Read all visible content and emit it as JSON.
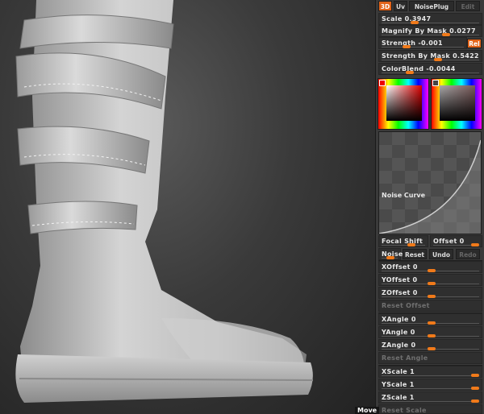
{
  "tabs": {
    "t3d": "3D",
    "uv": "Uv",
    "noiseplug": "NoisePlug",
    "edit": "Edit"
  },
  "sliders": {
    "scale": {
      "label": "Scale",
      "value": "0.3947",
      "level": 0.39
    },
    "magnify": {
      "label": "Magnify By Mask",
      "value": "0.0277",
      "level": 0.62
    },
    "strength": {
      "label": "Strength",
      "value": "-0.001",
      "level": 0.25
    },
    "rel": "Rel",
    "strength_mask": {
      "label": "Strength By Mask",
      "value": "0.5422",
      "level": 0.54
    },
    "colorblend": {
      "label": "ColorBlend",
      "value": "-0.0044",
      "level": 0.2
    }
  },
  "curve": {
    "label": "Noise Curve"
  },
  "focal": {
    "label": "Focal Shift",
    "level": 0.6
  },
  "offset": {
    "label": "Offset",
    "value": "0",
    "level": 0.85
  },
  "noise_row": {
    "label": "Noise",
    "reset": "Reset",
    "undo": "Undo",
    "redo": "Redo"
  },
  "axes": {
    "xoffset": {
      "label": "XOffset",
      "value": "0",
      "level": 0.5
    },
    "yoffset": {
      "label": "YOffset",
      "value": "0",
      "level": 0.5
    },
    "zoffset": {
      "label": "ZOffset",
      "value": "0",
      "level": 0.5
    },
    "reset_offset": "Reset Offset",
    "xangle": {
      "label": "XAngle",
      "value": "0",
      "level": 0.5
    },
    "yangle": {
      "label": "YAngle",
      "value": "0",
      "level": 0.5
    },
    "zangle": {
      "label": "ZAngle",
      "value": "0",
      "level": 0.5
    },
    "reset_angle": "Reset Angle",
    "xscale": {
      "label": "XScale",
      "value": "1",
      "level": 1
    },
    "yscale": {
      "label": "YScale",
      "value": "1",
      "level": 1
    },
    "zscale": {
      "label": "ZScale",
      "value": "1",
      "level": 1
    },
    "reset_scale": "Reset Scale"
  },
  "status": {
    "move": "Move"
  },
  "colors": {
    "accent": "#f07a1a",
    "panel": "#3a3a3a"
  }
}
